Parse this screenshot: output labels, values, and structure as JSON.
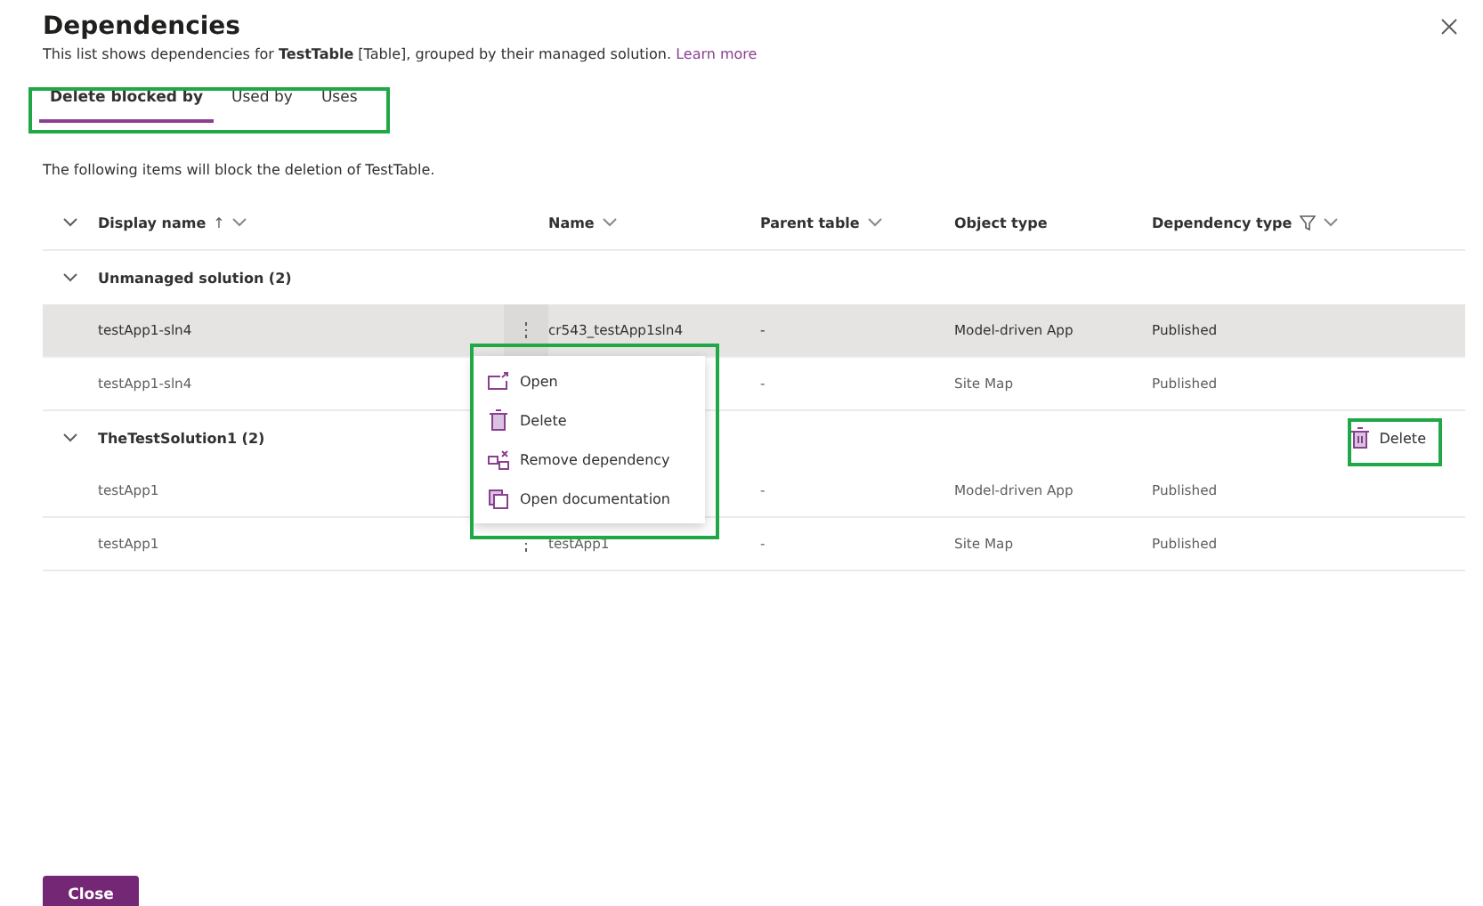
{
  "dialog": {
    "title": "Dependencies",
    "description": "This list shows dependencies for **TestTable** [Table], grouped by their managed solution.",
    "link": "Learn more"
  },
  "tabs": [
    {
      "label": "Delete blocked by",
      "selected": true
    },
    {
      "label": "Used by",
      "selected": false
    },
    {
      "label": "Uses",
      "selected": false
    }
  ],
  "info": "The following items will block the deletion of TestTable.",
  "table": {
    "columns": [
      {
        "label": "Display name",
        "sort": "↑",
        "dropdown": true,
        "filter": false
      },
      {
        "label": "Name",
        "dropdown": true,
        "filter": false
      },
      {
        "label": "Parent table",
        "dropdown": true,
        "filter": false
      },
      {
        "label": "Object type",
        "dropdown": false,
        "filter": false
      },
      {
        "label": "Dependency type",
        "dropdown": true,
        "filter": true
      }
    ],
    "groups": [
      {
        "title": "Unmanaged solution (2)",
        "expanded": true,
        "rows": [
          {
            "display_name": "testApp1-sln4",
            "more": true,
            "name": "cr543_testApp1sln4",
            "parent_table": "-",
            "object_type": "Model-driven App",
            "dependency_type": "Published",
            "selected": true
          },
          {
            "display_name": "testApp1-sln4",
            "more": false,
            "parent_table": "-",
            "object_type": "Site Map",
            "dependency_type": "Published",
            "selected": false
          }
        ]
      },
      {
        "title": "TheTestSolution1 (2)",
        "expanded": true,
        "action": "Delete",
        "rows": [
          {
            "display_name": "testApp1",
            "more": false,
            "parent_table": "-",
            "object_type": "Model-driven App",
            "dependency_type": "Published",
            "selected": false
          },
          {
            "display_name": "testApp1",
            "more": true,
            "name": "testApp1",
            "parent_table": "-",
            "object_type": "Site Map",
            "dependency_type": "Published",
            "selected": false
          }
        ]
      }
    ]
  },
  "context_menu": {
    "items": [
      {
        "label": "Open",
        "kind": "open"
      },
      {
        "label": "Delete",
        "kind": "delete"
      },
      {
        "label": "Remove dependency",
        "kind": "unlink"
      },
      {
        "label": "Open documentation",
        "kind": "document"
      }
    ]
  },
  "buttons": [
    "Close"
  ]
}
